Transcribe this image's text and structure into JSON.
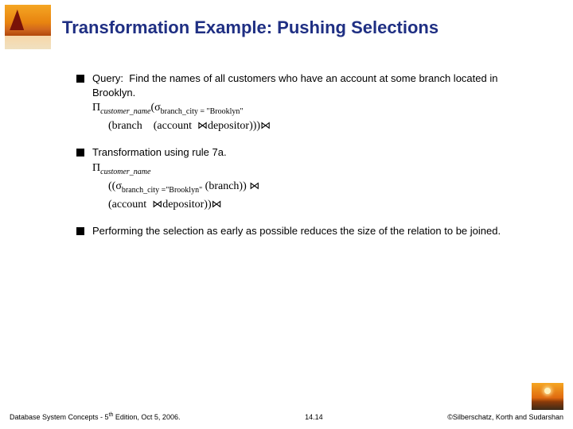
{
  "title": "Transformation Example: Pushing Selections",
  "items": {
    "q1": {
      "label": "Query:",
      "text": "Find the names of all customers who have an account at some branch located in Brooklyn."
    },
    "expr1": {
      "pi": "Π",
      "pi_sub": "customer_name",
      "sigma": "σ",
      "sigma_pred": "branch_city = \"Brooklyn\"",
      "line2_a": "(branch",
      "line2_b": "(account",
      "line2_c": "depositor)))"
    },
    "q2": {
      "text": "Transformation using rule 7a."
    },
    "expr2": {
      "pi": "Π",
      "pi_sub": "customer_name",
      "line2_a": "((",
      "sigma": "σ",
      "sigma_pred": "branch_city =\"Brooklyn\"",
      "line2_b": "(branch))",
      "line3_a": "(account",
      "line3_b": "depositor))"
    },
    "q3": {
      "text": "Performing the selection as early as possible reduces the size of the relation to be joined."
    }
  },
  "join_symbol": "⋈",
  "footer": {
    "left_a": "Database System Concepts - 5",
    "left_sup": "th",
    "left_b": " Edition, Oct 5, 2006.",
    "center": "14.14",
    "right": "©Silberschatz, Korth and Sudarshan"
  }
}
